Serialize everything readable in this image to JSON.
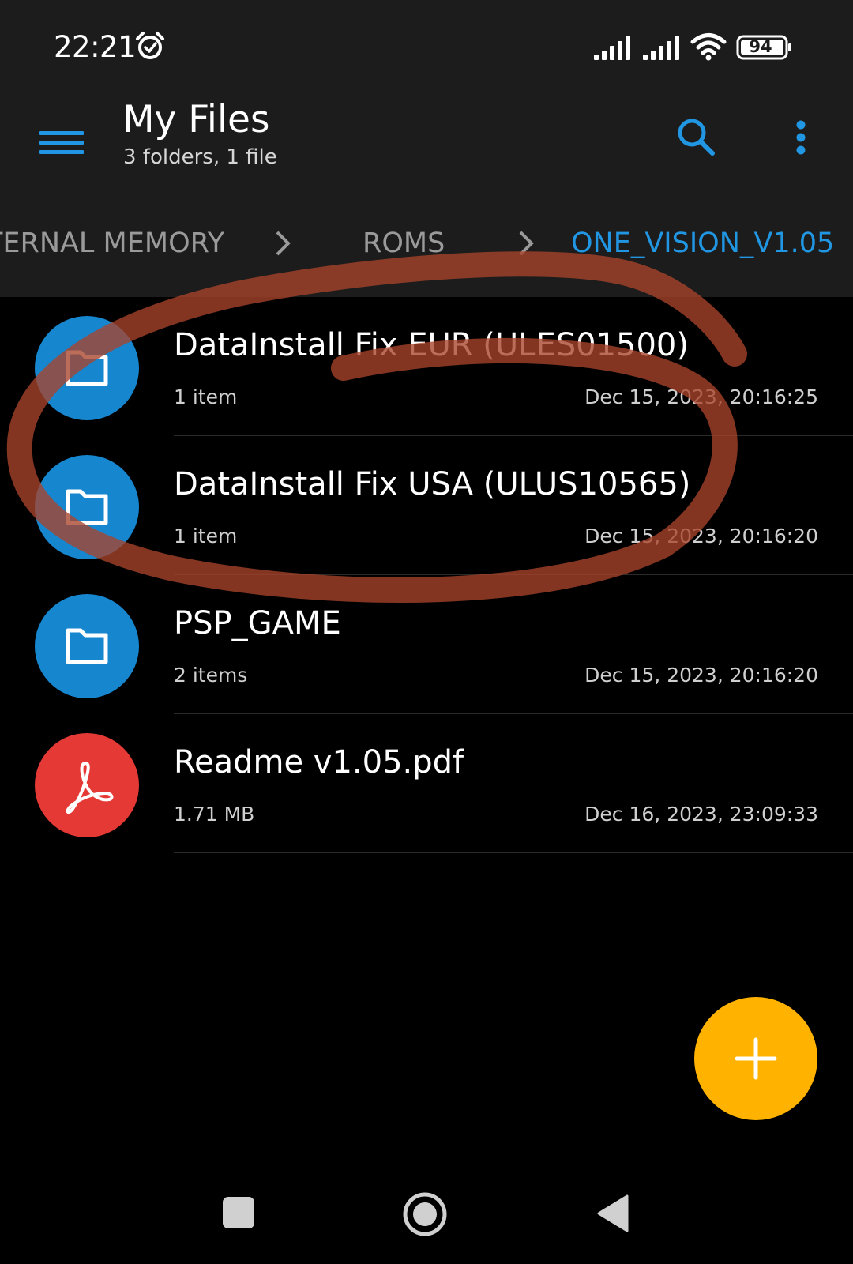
{
  "status_bar": {
    "time": "22:21",
    "battery_level": "94",
    "icons": [
      "alarm-icon",
      "signal-icon",
      "signal-icon",
      "wifi-icon",
      "battery-icon"
    ]
  },
  "app_bar": {
    "title": "My Files",
    "subtitle": "3 folders, 1 file",
    "icons": [
      "menu-icon",
      "search-icon",
      "more-vert-icon"
    ]
  },
  "breadcrumb": {
    "items": [
      "TERNAL MEMORY",
      "ROMS",
      "ONE_VISION_V1.05"
    ]
  },
  "files": [
    {
      "name": "DataInstall Fix EUR (ULES01500)",
      "meta": "1 item",
      "date": "Dec 15, 2023, 20:16:25",
      "icon": "folder-icon"
    },
    {
      "name": "DataInstall Fix USA (ULUS10565)",
      "meta": "1 item",
      "date": "Dec 15, 2023, 20:16:20",
      "icon": "folder-icon"
    },
    {
      "name": "PSP_GAME",
      "meta": "2 items",
      "date": "Dec 15, 2023, 20:16:20",
      "icon": "folder-icon"
    },
    {
      "name": "Readme v1.05.pdf",
      "meta": "1.71 MB",
      "date": "Dec 16, 2023, 23:09:33",
      "icon": "pdf-icon"
    }
  ],
  "fab": {
    "icon": "plus-icon"
  },
  "colors": {
    "accent": "#2196e3",
    "folder": "#1686cf",
    "pdf": "#e53935",
    "fab": "#ffb300",
    "annotation": "#c0502f",
    "bar_background": "#1c1c1c",
    "background": "#000000"
  },
  "nav_bar": {
    "icons": [
      "recents-icon",
      "home-icon",
      "back-icon"
    ]
  }
}
